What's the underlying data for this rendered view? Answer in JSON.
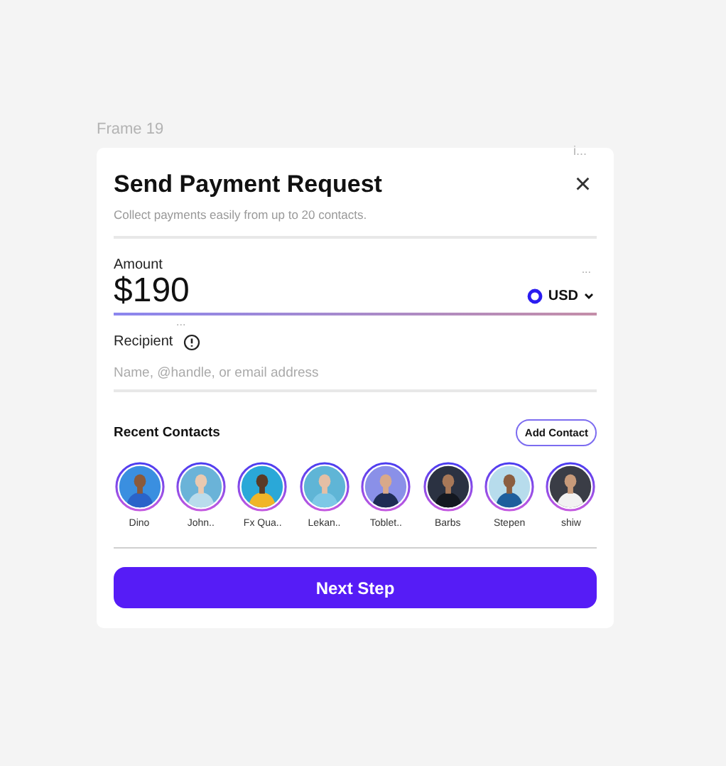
{
  "canvas": {
    "frame_label": "Frame 19"
  },
  "card": {
    "corner_mark": "i...",
    "title": "Send Payment Request",
    "subtitle": "Collect payments easily from up to 20 contacts.",
    "close": "×"
  },
  "amount": {
    "label": "Amount",
    "value": "$190",
    "currency": "USD",
    "top_mark": "...",
    "bottom_mark": "..."
  },
  "recipient": {
    "label": "Recipient",
    "placeholder": "Name, @handle, or email address"
  },
  "recent_contacts": {
    "title": "Recent Contacts",
    "add_button": "Add Contact",
    "contacts": [
      {
        "name": "Dino",
        "kind": "picture"
      },
      {
        "name": "John..",
        "kind": "picture"
      },
      {
        "name": "Fx Qua..",
        "kind": "picture"
      },
      {
        "name": "Lekan..",
        "kind": "picture"
      },
      {
        "name": "Toblet..",
        "kind": "picture"
      },
      {
        "name": "Barbs",
        "kind": "picture"
      },
      {
        "name": "Stepen",
        "kind": "picture"
      },
      {
        "name": "shiw",
        "kind": "picture"
      }
    ]
  },
  "primary_button": "Next Step"
}
